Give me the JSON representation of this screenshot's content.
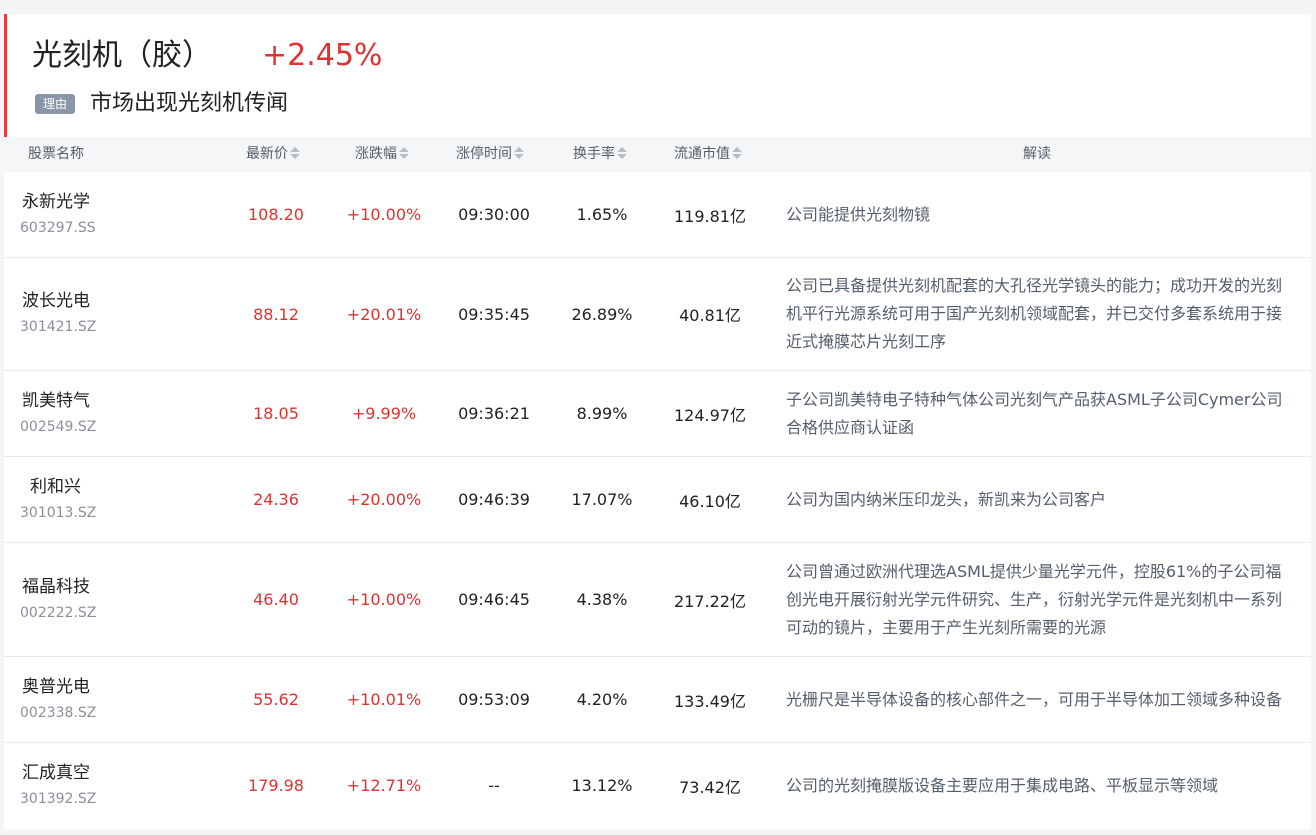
{
  "header": {
    "title": "光刻机（胶）",
    "change": "+2.45%",
    "reason_badge": "理由",
    "reason_text": "市场出现光刻机传闻"
  },
  "columns": {
    "name": "股票名称",
    "price": "最新价",
    "pct": "涨跌幅",
    "limit_time": "涨停时间",
    "turnover": "换手率",
    "float_cap": "流通市值",
    "note": "解读"
  },
  "rows": [
    {
      "name": "永新光学",
      "code": "603297.SS",
      "price": "108.20",
      "pct": "+10.00%",
      "time": "09:30:00",
      "turnover": "1.65%",
      "cap": "119.81亿",
      "note": "公司能提供光刻物镜"
    },
    {
      "name": "波长光电",
      "code": "301421.SZ",
      "price": "88.12",
      "pct": "+20.01%",
      "time": "09:35:45",
      "turnover": "26.89%",
      "cap": "40.81亿",
      "note": "公司已具备提供光刻机配套的大孔径光学镜头的能力；成功开发的光刻机平行光源系统可用于国产光刻机领域配套，并已交付多套系统用于接近式掩膜芯片光刻工序"
    },
    {
      "name": "凯美特气",
      "code": "002549.SZ",
      "price": "18.05",
      "pct": "+9.99%",
      "time": "09:36:21",
      "turnover": "8.99%",
      "cap": "124.97亿",
      "note": "子公司凯美特电子特种气体公司光刻气产品获ASML子公司Cymer公司合格供应商认证函"
    },
    {
      "name": "利和兴",
      "code": "301013.SZ",
      "price": "24.36",
      "pct": "+20.00%",
      "time": "09:46:39",
      "turnover": "17.07%",
      "cap": "46.10亿",
      "note": "公司为国内纳米压印龙头，新凯来为公司客户"
    },
    {
      "name": "福晶科技",
      "code": "002222.SZ",
      "price": "46.40",
      "pct": "+10.00%",
      "time": "09:46:45",
      "turnover": "4.38%",
      "cap": "217.22亿",
      "note": "公司曾通过欧洲代理选ASML提供少量光学元件，控股61%的子公司福创光电开展衍射光学元件研究、生产，衍射光学元件是光刻机中一系列可动的镜片，主要用于产生光刻所需要的光源"
    },
    {
      "name": "奥普光电",
      "code": "002338.SZ",
      "price": "55.62",
      "pct": "+10.01%",
      "time": "09:53:09",
      "turnover": "4.20%",
      "cap": "133.49亿",
      "note": "光栅尺是半导体设备的核心部件之一，可用于半导体加工领域多种设备"
    },
    {
      "name": "汇成真空",
      "code": "301392.SZ",
      "price": "179.98",
      "pct": "+12.71%",
      "time": "--",
      "turnover": "13.12%",
      "cap": "73.42亿",
      "note": "公司的光刻掩膜版设备主要应用于集成电路、平板显示等领域"
    }
  ],
  "colors": {
    "accent": "#e63b3b",
    "rise": "#e03131",
    "badge": "#8a95a8",
    "header_bg": "#f5f6f8"
  }
}
